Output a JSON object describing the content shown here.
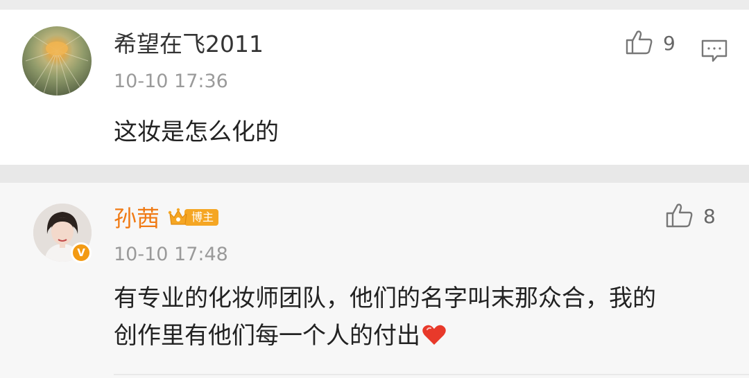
{
  "comments": [
    {
      "username": "希望在飞2011",
      "timestamp": "10-10 17:36",
      "text": "这妆是怎么化的",
      "likes": "9"
    },
    {
      "username": "孙茜",
      "badge": "博主",
      "verified_mark": "V",
      "timestamp": "10-10 17:48",
      "text_line_1": "有专业的化妆师团队，他们的名字叫末那众合，我的",
      "text_line_2": "创作里有他们每一个人的付出",
      "likes": "8"
    }
  ],
  "icons": {
    "like": "thumbs-up-icon",
    "reply": "comment-bubble-icon",
    "heart": "heart-icon",
    "crown": "crown-icon"
  },
  "colors": {
    "blogger_name": "#f07a14",
    "badge_bg": "#f5a623",
    "verified_bg": "#f39a13",
    "heart": "#e8392a"
  }
}
